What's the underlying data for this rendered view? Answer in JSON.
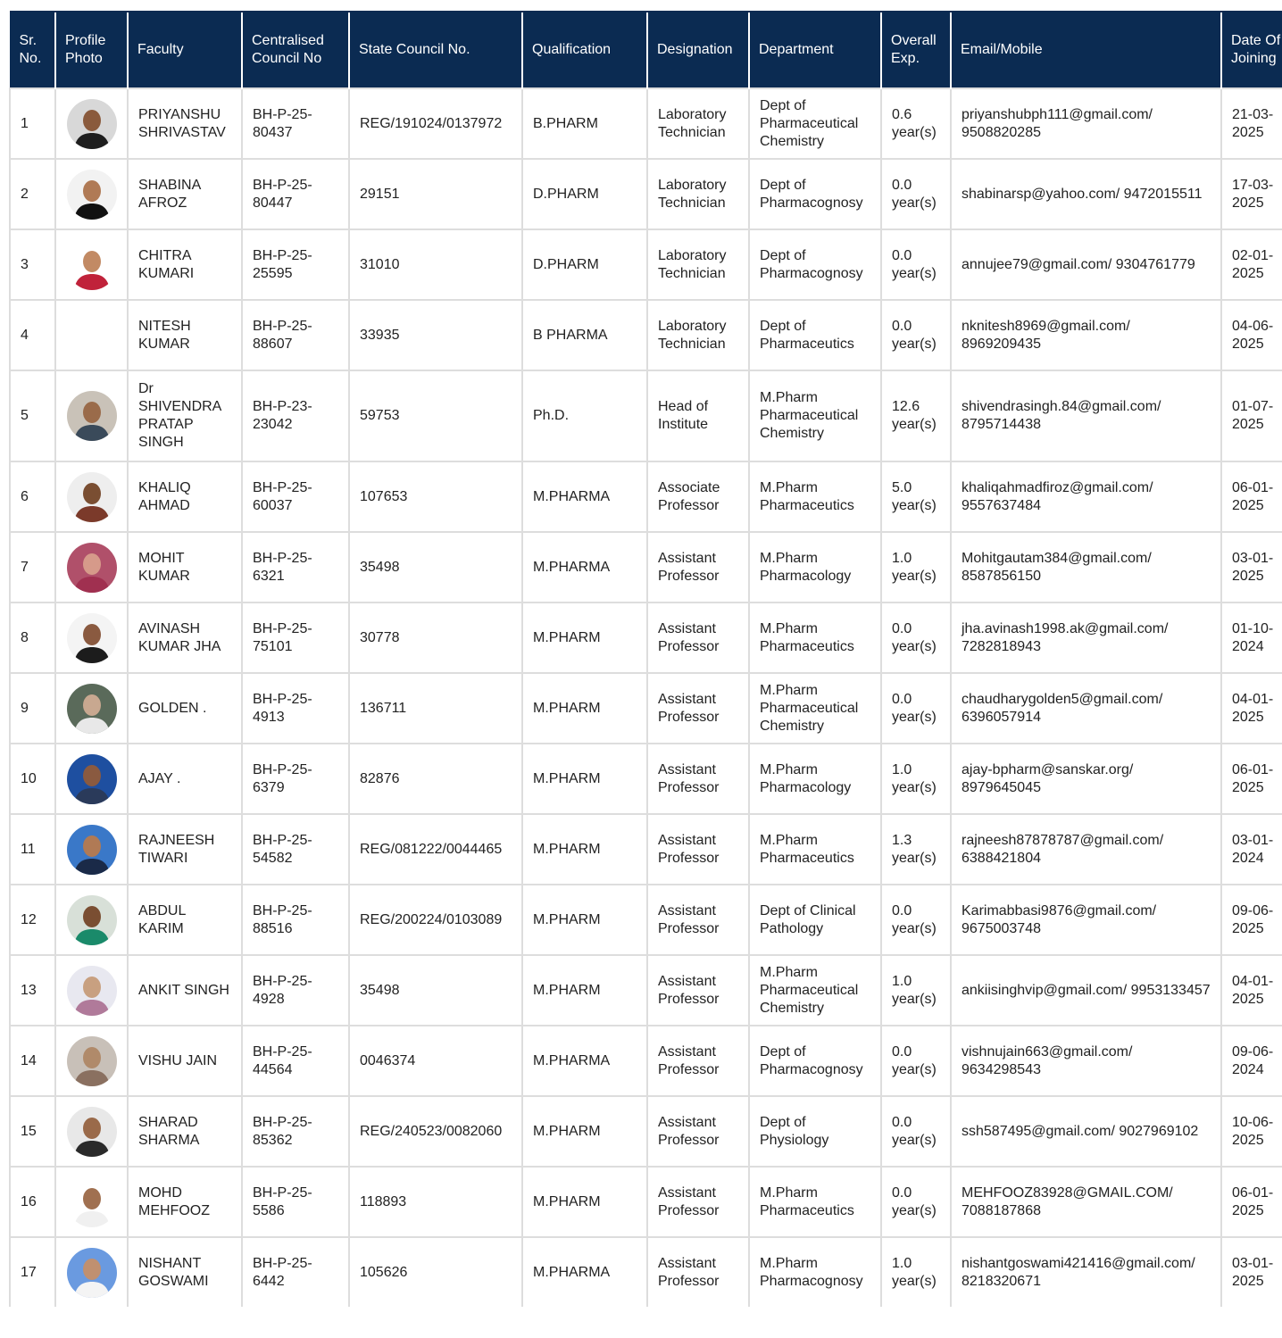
{
  "headers": {
    "sr": "Sr. No.",
    "photo": "Profile Photo",
    "faculty": "Faculty",
    "central": "Centralised Council No",
    "state": "State Council No.",
    "qual": "Qualification",
    "desig": "Designation",
    "dept": "Department",
    "exp": "Overall Exp.",
    "email": "Email/Mobile",
    "doj": "Date Of Joining"
  },
  "rows": [
    {
      "sr": "1",
      "faculty": "PRIYANSHU SHRIVASTAV",
      "central": "BH-P-25-80437",
      "state": "REG/191024/0137972",
      "qual": "B.PHARM",
      "desig": "Laboratory Technician",
      "dept": "Dept of Pharmaceutical Chemistry",
      "exp": "0.6 year(s)",
      "email": "priyanshubph111@gmail.com/ 9508820285",
      "doj": "21-03-2025",
      "photo": {
        "bg": "#d8d8d8",
        "skin": "#8a5a3c",
        "cloth": "#1e1e1e"
      }
    },
    {
      "sr": "2",
      "faculty": "SHABINA AFROZ",
      "central": "BH-P-25-80447",
      "state": "29151",
      "qual": "D.PHARM",
      "desig": "Laboratory Technician",
      "dept": "Dept of Pharmacognosy",
      "exp": "0.0 year(s)",
      "email": "shabinarsp@yahoo.com/ 9472015511",
      "doj": "17-03-2025",
      "photo": {
        "bg": "#f2f2f2",
        "skin": "#b07a55",
        "cloth": "#111111"
      }
    },
    {
      "sr": "3",
      "faculty": "CHITRA KUMARI",
      "central": "BH-P-25-25595",
      "state": "31010",
      "qual": "D.PHARM",
      "desig": "Laboratory Technician",
      "dept": "Dept of Pharmacognosy",
      "exp": "0.0 year(s)",
      "email": "annujee79@gmail.com/ 9304761779",
      "doj": "02-01-2025",
      "photo": {
        "bg": "#ffffff",
        "skin": "#c28a64",
        "cloth": "#c0223a"
      }
    },
    {
      "sr": "4",
      "faculty": "NITESH KUMAR",
      "central": "BH-P-25-88607",
      "state": "33935",
      "qual": "B PHARMA",
      "desig": "Laboratory Technician",
      "dept": "Dept of Pharmaceutics",
      "exp": "0.0 year(s)",
      "email": "nknitesh8969@gmail.com/ 8969209435",
      "doj": "04-06-2025",
      "photo": {
        "bg": "#ffffff",
        "skin": "#ffffff",
        "cloth": "#ffffff"
      }
    },
    {
      "sr": "5",
      "faculty": "Dr SHIVENDRA PRATAP SINGH",
      "central": "BH-P-23-23042",
      "state": "59753",
      "qual": "Ph.D.",
      "desig": "Head of Institute",
      "dept": "M.Pharm Pharmaceutical Chemistry",
      "exp": "12.6 year(s)",
      "email": "shivendrasingh.84@gmail.com/ 8795714438",
      "doj": "01-07-2025",
      "photo": {
        "bg": "#c9c2b8",
        "skin": "#9a6b4a",
        "cloth": "#3a4a5a"
      }
    },
    {
      "sr": "6",
      "faculty": "KHALIQ AHMAD",
      "central": "BH-P-25-60037",
      "state": "107653",
      "qual": "M.PHARMA",
      "desig": "Associate Professor",
      "dept": "M.Pharm Pharmaceutics",
      "exp": "5.0 year(s)",
      "email": "khaliqahmadfiroz@gmail.com/ 9557637484",
      "doj": "06-01-2025",
      "photo": {
        "bg": "#eeeeee",
        "skin": "#7a4e32",
        "cloth": "#7b3a2a"
      }
    },
    {
      "sr": "7",
      "faculty": "MOHIT KUMAR",
      "central": "BH-P-25-6321",
      "state": "35498",
      "qual": "M.PHARMA",
      "desig": "Assistant Professor",
      "dept": "M.Pharm Pharmacology",
      "exp": "1.0 year(s)",
      "email": "Mohitgautam384@gmail.com/ 8587856150",
      "doj": "03-01-2025",
      "photo": {
        "bg": "#b0506a",
        "skin": "#d69a8a",
        "cloth": "#a03050"
      }
    },
    {
      "sr": "8",
      "faculty": "AVINASH KUMAR JHA",
      "central": "BH-P-25-75101",
      "state": "30778",
      "qual": "M.PHARM",
      "desig": "Assistant Professor",
      "dept": "M.Pharm Pharmaceutics",
      "exp": "0.0 year(s)",
      "email": "jha.avinash1998.ak@gmail.com/ 7282818943",
      "doj": "01-10-2024",
      "photo": {
        "bg": "#f4f4f4",
        "skin": "#8a5a40",
        "cloth": "#1c1c1c"
      }
    },
    {
      "sr": "9",
      "faculty": "GOLDEN .",
      "central": "BH-P-25-4913",
      "state": "136711",
      "qual": "M.PHARM",
      "desig": "Assistant Professor",
      "dept": "M.Pharm Pharmaceutical Chemistry",
      "exp": "0.0 year(s)",
      "email": "chaudharygolden5@gmail.com/ 6396057914",
      "doj": "04-01-2025",
      "photo": {
        "bg": "#5a6a5a",
        "skin": "#c8a890",
        "cloth": "#e8e8e8"
      }
    },
    {
      "sr": "10",
      "faculty": "AJAY .",
      "central": "BH-P-25-6379",
      "state": "82876",
      "qual": "M.PHARM",
      "desig": "Assistant Professor",
      "dept": "M.Pharm Pharmacology",
      "exp": "1.0 year(s)",
      "email": "ajay-bpharm@sanskar.org/ 8979645045",
      "doj": "06-01-2025",
      "photo": {
        "bg": "#1e4fa0",
        "skin": "#8a5a40",
        "cloth": "#2a3a5a"
      }
    },
    {
      "sr": "11",
      "faculty": "RAJNEESH TIWARI",
      "central": "BH-P-25-54582",
      "state": "REG/081222/0044465",
      "qual": "M.PHARM",
      "desig": "Assistant Professor",
      "dept": "M.Pharm Pharmaceutics",
      "exp": "1.3 year(s)",
      "email": "rajneesh87878787@gmail.com/ 6388421804",
      "doj": "03-01-2024",
      "photo": {
        "bg": "#3a78c8",
        "skin": "#b07a55",
        "cloth": "#1a2a48"
      }
    },
    {
      "sr": "12",
      "faculty": "ABDUL KARIM",
      "central": "BH-P-25-88516",
      "state": "REG/200224/0103089",
      "qual": "M.PHARM",
      "desig": "Assistant Professor",
      "dept": "Dept of Clinical Pathology",
      "exp": "0.0 year(s)",
      "email": "Karimabbasi9876@gmail.com/ 9675003748",
      "doj": "09-06-2025",
      "photo": {
        "bg": "#d8e0d8",
        "skin": "#7a4e32",
        "cloth": "#1a8a6a"
      }
    },
    {
      "sr": "13",
      "faculty": "ANKIT SINGH",
      "central": "BH-P-25-4928",
      "state": "35498",
      "qual": "M.PHARM",
      "desig": "Assistant Professor",
      "dept": "M.Pharm Pharmaceutical Chemistry",
      "exp": "1.0 year(s)",
      "email": "ankiisinghvip@gmail.com/ 9953133457",
      "doj": "04-01-2025",
      "photo": {
        "bg": "#e8e8f0",
        "skin": "#c8a080",
        "cloth": "#b07a9a"
      }
    },
    {
      "sr": "14",
      "faculty": "VISHU JAIN",
      "central": "BH-P-25-44564",
      "state": "0046374",
      "qual": "M.PHARMA",
      "desig": "Assistant Professor",
      "dept": "Dept of Pharmacognosy",
      "exp": "0.0 year(s)",
      "email": "vishnujain663@gmail.com/ 9634298543",
      "doj": "09-06-2024",
      "photo": {
        "bg": "#c8c0b8",
        "skin": "#b08a6a",
        "cloth": "#8a7060"
      }
    },
    {
      "sr": "15",
      "faculty": "SHARAD SHARMA",
      "central": "BH-P-25-85362",
      "state": "REG/240523/0082060",
      "qual": "M.PHARM",
      "desig": "Assistant Professor",
      "dept": "Dept of Physiology",
      "exp": "0.0 year(s)",
      "email": "ssh587495@gmail.com/ 9027969102",
      "doj": "10-06-2025",
      "photo": {
        "bg": "#e8e8e8",
        "skin": "#9a6a4a",
        "cloth": "#2a2a2a"
      }
    },
    {
      "sr": "16",
      "faculty": "MOHD MEHFOOZ",
      "central": "BH-P-25-5586",
      "state": "118893",
      "qual": "M.PHARM",
      "desig": "Assistant Professor",
      "dept": "M.Pharm Pharmaceutics",
      "exp": "0.0 year(s)",
      "email": "MEHFOOZ83928@GMAIL.COM/ 7088187868",
      "doj": "06-01-2025",
      "photo": {
        "bg": "#ffffff",
        "skin": "#a07050",
        "cloth": "#f0f0f0"
      }
    },
    {
      "sr": "17",
      "faculty": "NISHANT GOSWAMI",
      "central": "BH-P-25-6442",
      "state": "105626",
      "qual": "M.PHARMA",
      "desig": "Assistant Professor",
      "dept": "M.Pharm Pharmacognosy",
      "exp": "1.0 year(s)",
      "email": "nishantgoswami421416@gmail.com/ 8218320671",
      "doj": "03-01-2025",
      "photo": {
        "bg": "#6a9ae0",
        "skin": "#c09070",
        "cloth": "#f4f4f4"
      }
    }
  ]
}
